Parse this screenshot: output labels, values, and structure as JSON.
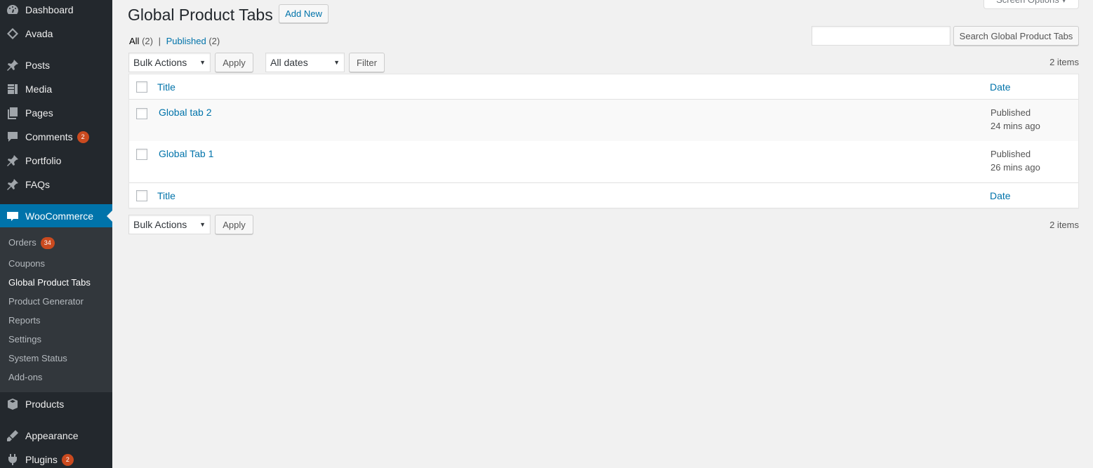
{
  "sidebar": {
    "items": [
      {
        "label": "Dashboard",
        "icon": "dashboard-icon"
      },
      {
        "label": "Avada",
        "icon": "avada-icon"
      },
      {
        "label": "Posts",
        "icon": "pin-icon"
      },
      {
        "label": "Media",
        "icon": "media-icon"
      },
      {
        "label": "Pages",
        "icon": "pages-icon"
      },
      {
        "label": "Comments",
        "icon": "comments-icon",
        "badge": "2"
      },
      {
        "label": "Portfolio",
        "icon": "pin-icon"
      },
      {
        "label": "FAQs",
        "icon": "pin-icon"
      },
      {
        "label": "WooCommerce",
        "icon": "woo-icon"
      },
      {
        "label": "Products",
        "icon": "products-icon"
      },
      {
        "label": "Appearance",
        "icon": "appearance-icon"
      },
      {
        "label": "Plugins",
        "icon": "plugins-icon",
        "badge": "2"
      }
    ],
    "submenu": [
      {
        "label": "Orders",
        "badge": "34"
      },
      {
        "label": "Coupons"
      },
      {
        "label": "Global Product Tabs"
      },
      {
        "label": "Product Generator"
      },
      {
        "label": "Reports"
      },
      {
        "label": "Settings"
      },
      {
        "label": "System Status"
      },
      {
        "label": "Add-ons"
      }
    ]
  },
  "header": {
    "title": "Global Product Tabs",
    "add_new": "Add New",
    "screen_options": "Screen Options ▾"
  },
  "filters": {
    "all": "All",
    "all_count": "(2)",
    "separator": "|",
    "published": "Published",
    "published_count": "(2)"
  },
  "search": {
    "value": "",
    "button": "Search Global Product Tabs"
  },
  "toolbar": {
    "bulk_actions": "Bulk Actions",
    "apply": "Apply",
    "dates": "All dates",
    "filter": "Filter",
    "items_count": "2 items"
  },
  "table": {
    "col_title": "Title",
    "col_date": "Date",
    "rows": [
      {
        "title": "Global tab 2",
        "status": "Published",
        "when": "24 mins ago"
      },
      {
        "title": "Global Tab 1",
        "status": "Published",
        "when": "26 mins ago"
      }
    ]
  },
  "colors": {
    "sidebar_bg": "#23282d",
    "submenu_bg": "#32373c",
    "accent": "#0073aa",
    "badge": "#ca4a1f"
  }
}
